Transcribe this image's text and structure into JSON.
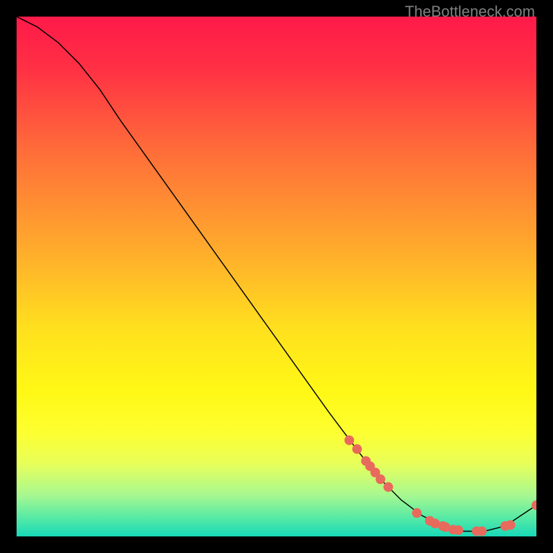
{
  "watermark": "TheBottleneck.com",
  "chart_data": {
    "type": "line",
    "title": "",
    "xlabel": "",
    "ylabel": "",
    "xlim": [
      0,
      100
    ],
    "ylim": [
      0,
      100
    ],
    "grid": false,
    "series": [
      {
        "name": "curve",
        "type": "line",
        "color": "#000000",
        "x": [
          0,
          4,
          8,
          12,
          16,
          20,
          30,
          40,
          50,
          60,
          66,
          70,
          74,
          78,
          82,
          86,
          90,
          94,
          97,
          100
        ],
        "y": [
          100,
          98,
          95,
          91,
          86,
          80,
          66,
          52,
          38,
          24,
          16,
          11,
          7,
          4,
          2,
          1,
          1,
          2,
          4,
          6
        ]
      },
      {
        "name": "segment-markers",
        "type": "scatter",
        "color": "#e86a5c",
        "x": [
          64,
          65.5,
          67.2,
          68,
          69,
          70,
          71.5,
          77,
          79.5,
          80.5,
          82,
          82.5,
          84,
          85,
          88.5,
          89.5,
          94,
          95,
          100
        ],
        "y": [
          18.5,
          16.8,
          14.5,
          13.5,
          12.3,
          11,
          9.5,
          4.5,
          3,
          2.5,
          2,
          1.8,
          1.3,
          1.2,
          1,
          1,
          2,
          2.2,
          6
        ]
      }
    ],
    "background_gradient": {
      "type": "vertical",
      "stops": [
        {
          "offset": 0.0,
          "color": "#ff1a4a"
        },
        {
          "offset": 0.1,
          "color": "#ff3044"
        },
        {
          "offset": 0.25,
          "color": "#ff6a3a"
        },
        {
          "offset": 0.45,
          "color": "#ffac2c"
        },
        {
          "offset": 0.6,
          "color": "#ffe01e"
        },
        {
          "offset": 0.72,
          "color": "#fff815"
        },
        {
          "offset": 0.8,
          "color": "#fdff30"
        },
        {
          "offset": 0.86,
          "color": "#e8ff5a"
        },
        {
          "offset": 0.92,
          "color": "#a8f890"
        },
        {
          "offset": 0.97,
          "color": "#4ce8a8"
        },
        {
          "offset": 1.0,
          "color": "#18d8b8"
        }
      ]
    }
  }
}
